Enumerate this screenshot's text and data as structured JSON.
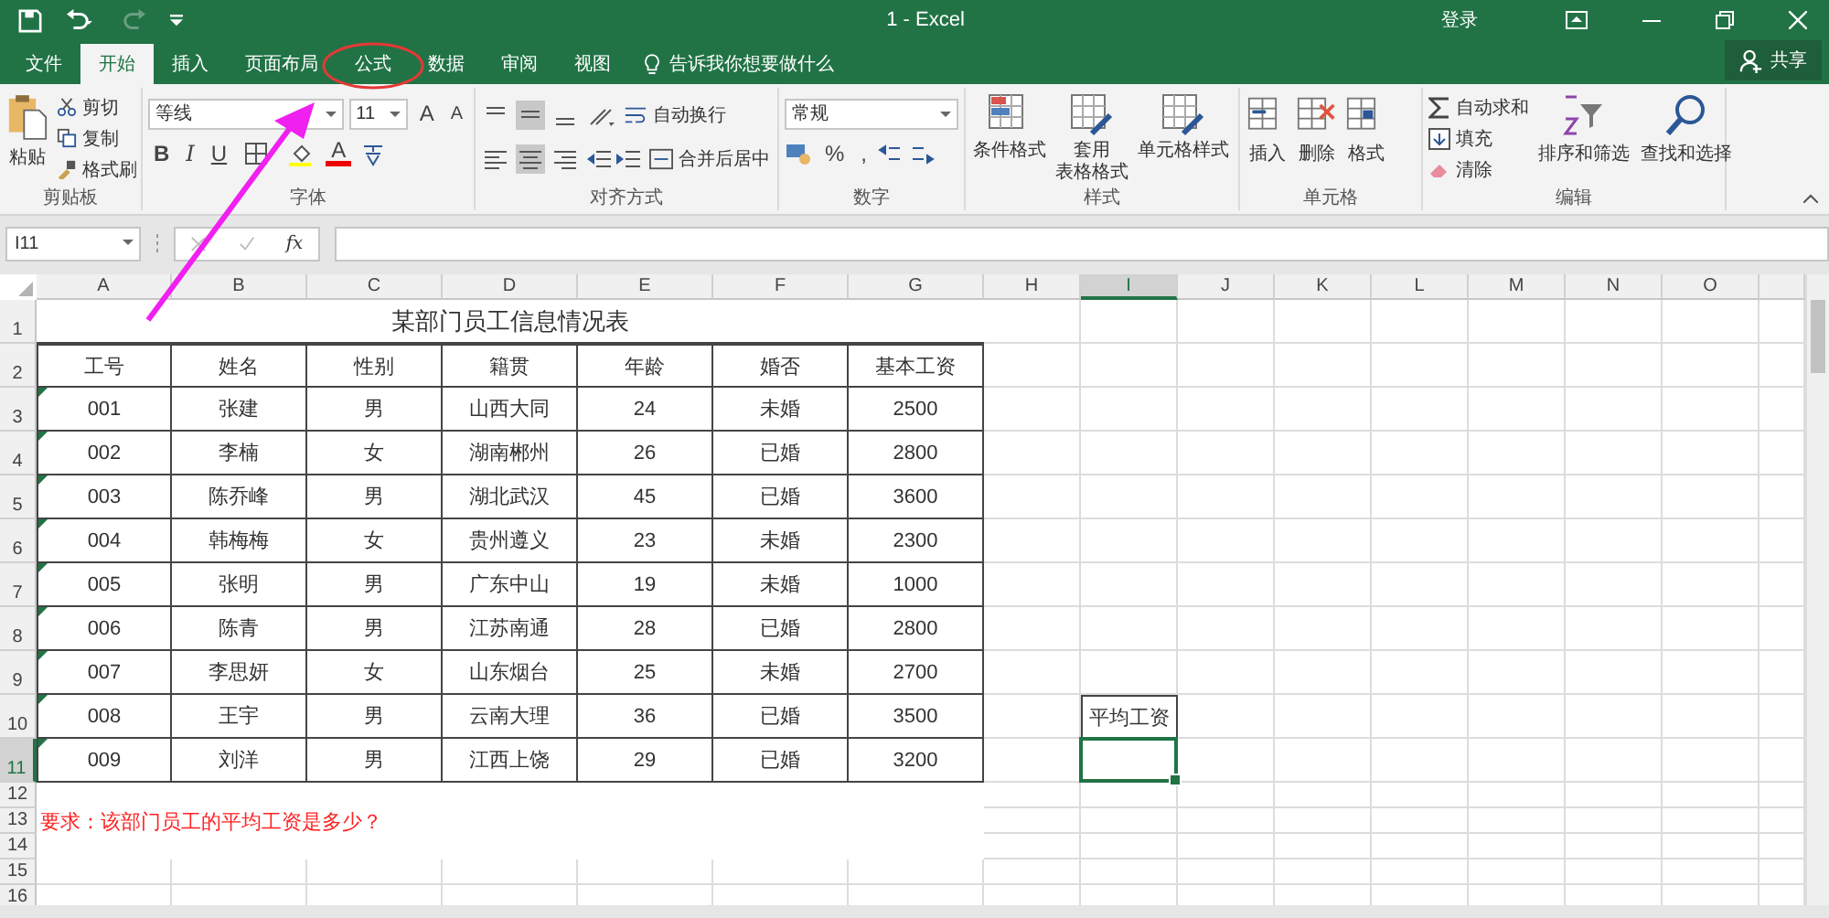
{
  "window": {
    "title": "1  -  Excel",
    "sign_in": "登录"
  },
  "tabs": [
    {
      "label": "文件",
      "selected": false
    },
    {
      "label": "开始",
      "selected": true
    },
    {
      "label": "插入",
      "selected": false
    },
    {
      "label": "页面布局",
      "selected": false
    },
    {
      "label": "公式",
      "selected": false
    },
    {
      "label": "数据",
      "selected": false
    },
    {
      "label": "审阅",
      "selected": false
    },
    {
      "label": "视图",
      "selected": false
    }
  ],
  "tell_me": "告诉我你想要做什么",
  "share": "共享",
  "ribbon": {
    "clipboard": {
      "label": "剪贴板",
      "paste": "粘贴",
      "items": [
        "剪切",
        "复制",
        "格式刷"
      ]
    },
    "font": {
      "label": "字体",
      "font_name": "等线",
      "font_size": "11",
      "grow": "A",
      "shrink": "A",
      "bold": "B",
      "italic": "I",
      "underline": "U",
      "font_color": "A"
    },
    "alignment": {
      "label": "对齐方式",
      "vertical": [
        {
          "selected": false
        },
        {
          "selected": true
        },
        {
          "selected": false
        }
      ],
      "horizontal": [
        {
          "selected": false
        },
        {
          "selected": true
        },
        {
          "selected": false
        }
      ],
      "wrap": "自动换行",
      "merge": "合并后居中"
    },
    "number": {
      "label": "数字",
      "format": "常规",
      "percent": "%",
      "comma": ","
    },
    "styles": {
      "label": "样式",
      "buttons": [
        [
          "条件格式"
        ],
        [
          "套用",
          "表格格式"
        ],
        [
          "单元格样式"
        ]
      ]
    },
    "cells": {
      "label": "单元格",
      "buttons": [
        "插入",
        "删除",
        "格式"
      ]
    },
    "editing": {
      "label": "编辑",
      "items": [
        "自动求和",
        "填充",
        "清除"
      ],
      "buttons": [
        "排序和筛选",
        "查找和选择"
      ]
    }
  },
  "formula_bar": {
    "name_box": "I11",
    "fx": "fx"
  },
  "columns": [
    {
      "label": "A",
      "selected": false
    },
    {
      "label": "B",
      "selected": false
    },
    {
      "label": "C",
      "selected": false
    },
    {
      "label": "D",
      "selected": false
    },
    {
      "label": "E",
      "selected": false
    },
    {
      "label": "F",
      "selected": false
    },
    {
      "label": "G",
      "selected": false
    },
    {
      "label": "H",
      "selected": false
    },
    {
      "label": "I",
      "selected": true
    },
    {
      "label": "J",
      "selected": false
    },
    {
      "label": "K",
      "selected": false
    },
    {
      "label": "L",
      "selected": false
    },
    {
      "label": "M",
      "selected": false
    },
    {
      "label": "N",
      "selected": false
    },
    {
      "label": "O",
      "selected": false
    }
  ],
  "rows": [
    {
      "label": "1",
      "selected": false
    },
    {
      "label": "2",
      "selected": false
    },
    {
      "label": "3",
      "selected": false
    },
    {
      "label": "4",
      "selected": false
    },
    {
      "label": "5",
      "selected": false
    },
    {
      "label": "6",
      "selected": false
    },
    {
      "label": "7",
      "selected": false
    },
    {
      "label": "8",
      "selected": false
    },
    {
      "label": "9",
      "selected": false
    },
    {
      "label": "10",
      "selected": false
    },
    {
      "label": "11",
      "selected": true
    },
    {
      "label": "12",
      "selected": false
    },
    {
      "label": "13",
      "selected": false
    },
    {
      "label": "14",
      "selected": false
    },
    {
      "label": "15",
      "selected": false
    },
    {
      "label": "16",
      "selected": false
    }
  ],
  "sheet": {
    "title": "某部门员工信息情况表",
    "headers": [
      "工号",
      "姓名",
      "性别",
      "籍贯",
      "年龄",
      "婚否",
      "基本工资"
    ],
    "records": [
      {
        "cells": [
          "001",
          "张建",
          "男",
          "山西大同",
          "24",
          "未婚",
          "2500"
        ],
        "flag": true
      },
      {
        "cells": [
          "002",
          "李楠",
          "女",
          "湖南郴州",
          "26",
          "已婚",
          "2800"
        ],
        "flag": true
      },
      {
        "cells": [
          "003",
          "陈乔峰",
          "男",
          "湖北武汉",
          "45",
          "已婚",
          "3600"
        ],
        "flag": true
      },
      {
        "cells": [
          "004",
          "韩梅梅",
          "女",
          "贵州遵义",
          "23",
          "未婚",
          "2300"
        ],
        "flag": true
      },
      {
        "cells": [
          "005",
          "张明",
          "男",
          "广东中山",
          "19",
          "未婚",
          "1000"
        ],
        "flag": true
      },
      {
        "cells": [
          "006",
          "陈青",
          "男",
          "江苏南通",
          "28",
          "已婚",
          "2800"
        ],
        "flag": true
      },
      {
        "cells": [
          "007",
          "李思妍",
          "女",
          "山东烟台",
          "25",
          "未婚",
          "2700"
        ],
        "flag": true
      },
      {
        "cells": [
          "008",
          "王宇",
          "男",
          "云南大理",
          "36",
          "已婚",
          "3500"
        ],
        "flag": true
      },
      {
        "cells": [
          "009",
          "刘洋",
          "男",
          "江西上饶",
          "29",
          "已婚",
          "3200"
        ],
        "flag": true
      }
    ],
    "side_label": "平均工资",
    "note": "要求：该部门员工的平均工资是多少？"
  }
}
